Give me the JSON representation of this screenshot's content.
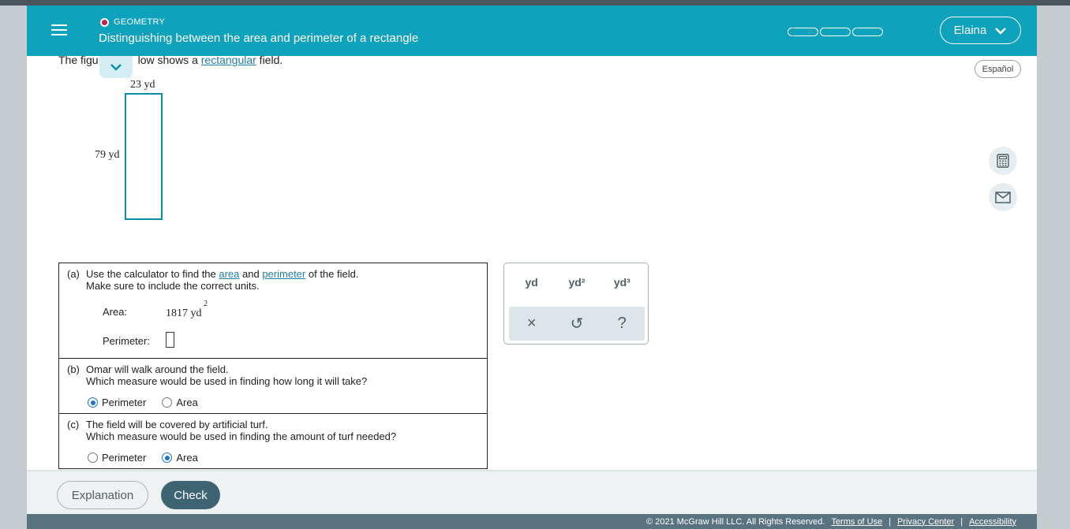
{
  "header": {
    "category": "GEOMETRY",
    "title": "Distinguishing between the area and perimeter of a rectangle",
    "user": "Elaina"
  },
  "intro": {
    "before": "The figu",
    "after": "low shows a ",
    "link": "rectangular",
    "end": " field."
  },
  "espanol": "Español",
  "figure": {
    "width_label": "23 yd",
    "height_label": "79 yd"
  },
  "part_a": {
    "tag": "(a)",
    "line1_pre": "Use the calculator to find the ",
    "area_link": "area",
    "and": " and ",
    "perimeter_link": "perimeter",
    "line1_post": " of the field.",
    "line2": "Make sure to include the correct units.",
    "area_label": "Area:",
    "area_value": "1817 yd",
    "area_exp": "2",
    "perimeter_label": "Perimeter:"
  },
  "part_b": {
    "tag": "(b)",
    "line1": "Omar will walk around the field.",
    "line2": "Which measure would be used in finding how long it will take?",
    "opt1": "Perimeter",
    "opt2": "Area",
    "selected": "Perimeter"
  },
  "part_c": {
    "tag": "(c)",
    "line1": "The field will be covered by artificial turf.",
    "line2": "Which measure would be used in finding the amount of turf needed?",
    "opt1": "Perimeter",
    "opt2": "Area",
    "selected": "Area"
  },
  "units": {
    "u1": "yd",
    "u2": "yd²",
    "u3": "yd³",
    "clear": "×",
    "undo": "↺",
    "help": "?"
  },
  "footer": {
    "explanation": "Explanation",
    "check": "Check",
    "copyright": "© 2021 McGraw Hill LLC. All Rights Reserved.",
    "terms": "Terms of Use",
    "privacy": "Privacy Center",
    "accessibility": "Accessibility",
    "sep": "|"
  },
  "colors": {
    "header": "#0ea2bd",
    "accent": "#1b7fa6",
    "check_button": "#3e6474",
    "category_dot": "#c41e4a"
  }
}
